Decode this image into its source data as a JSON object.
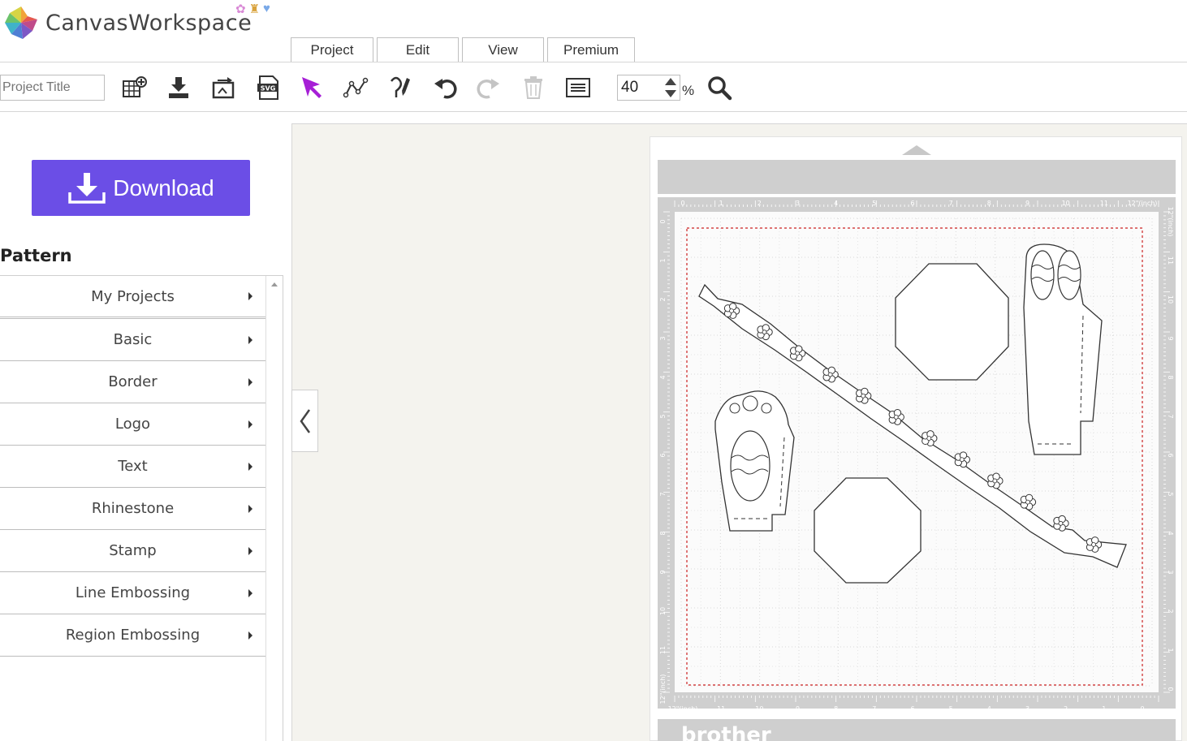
{
  "app": {
    "name": "CanvasWorkspace"
  },
  "menu": {
    "tabs": [
      "Project",
      "Edit",
      "View",
      "Premium"
    ]
  },
  "toolbar": {
    "project_title_placeholder": "Project Title",
    "zoom_value": "40",
    "zoom_unit": "%",
    "icons": [
      "new-pattern-icon",
      "download-project-icon",
      "import-icon",
      "svg-import-icon",
      "select-arrow-icon",
      "point-edit-icon",
      "draw-pen-icon",
      "undo-icon",
      "redo-icon",
      "delete-icon",
      "object-list-icon",
      "zoom-icon"
    ]
  },
  "sidebar": {
    "download_label": "Download",
    "pattern_heading": "Pattern",
    "items": [
      {
        "label": "My Projects"
      },
      {
        "label": "Basic"
      },
      {
        "label": "Border"
      },
      {
        "label": "Logo"
      },
      {
        "label": "Text"
      },
      {
        "label": "Rhinestone"
      },
      {
        "label": "Stamp"
      },
      {
        "label": "Line Embossing"
      },
      {
        "label": "Region Embossing"
      }
    ]
  },
  "mat": {
    "brand": "brother",
    "top_ruler": [
      "0",
      "1",
      "2",
      "3",
      "4",
      "5",
      "6",
      "7",
      "8",
      "9",
      "10",
      "11",
      "12\"(inch)"
    ],
    "left_ruler": [
      "0",
      "1",
      "2",
      "3",
      "4",
      "5",
      "6",
      "7",
      "8",
      "9",
      "10",
      "11",
      "12\"(inch)"
    ],
    "bottom_ruler": [
      "12\"(inch)",
      "11",
      "10",
      "9",
      "8",
      "7",
      "6",
      "5",
      "4",
      "3",
      "2",
      "1",
      "0"
    ],
    "right_ruler": [
      "12\"(inch)",
      "11",
      "10",
      "9",
      "8",
      "7",
      "6",
      "5",
      "4",
      "3",
      "2",
      "1",
      "0"
    ],
    "colors": {
      "cut_area_border": "#cc2222",
      "mat_frame": "#c8c8c8",
      "accent": "#6b4ee6"
    }
  }
}
